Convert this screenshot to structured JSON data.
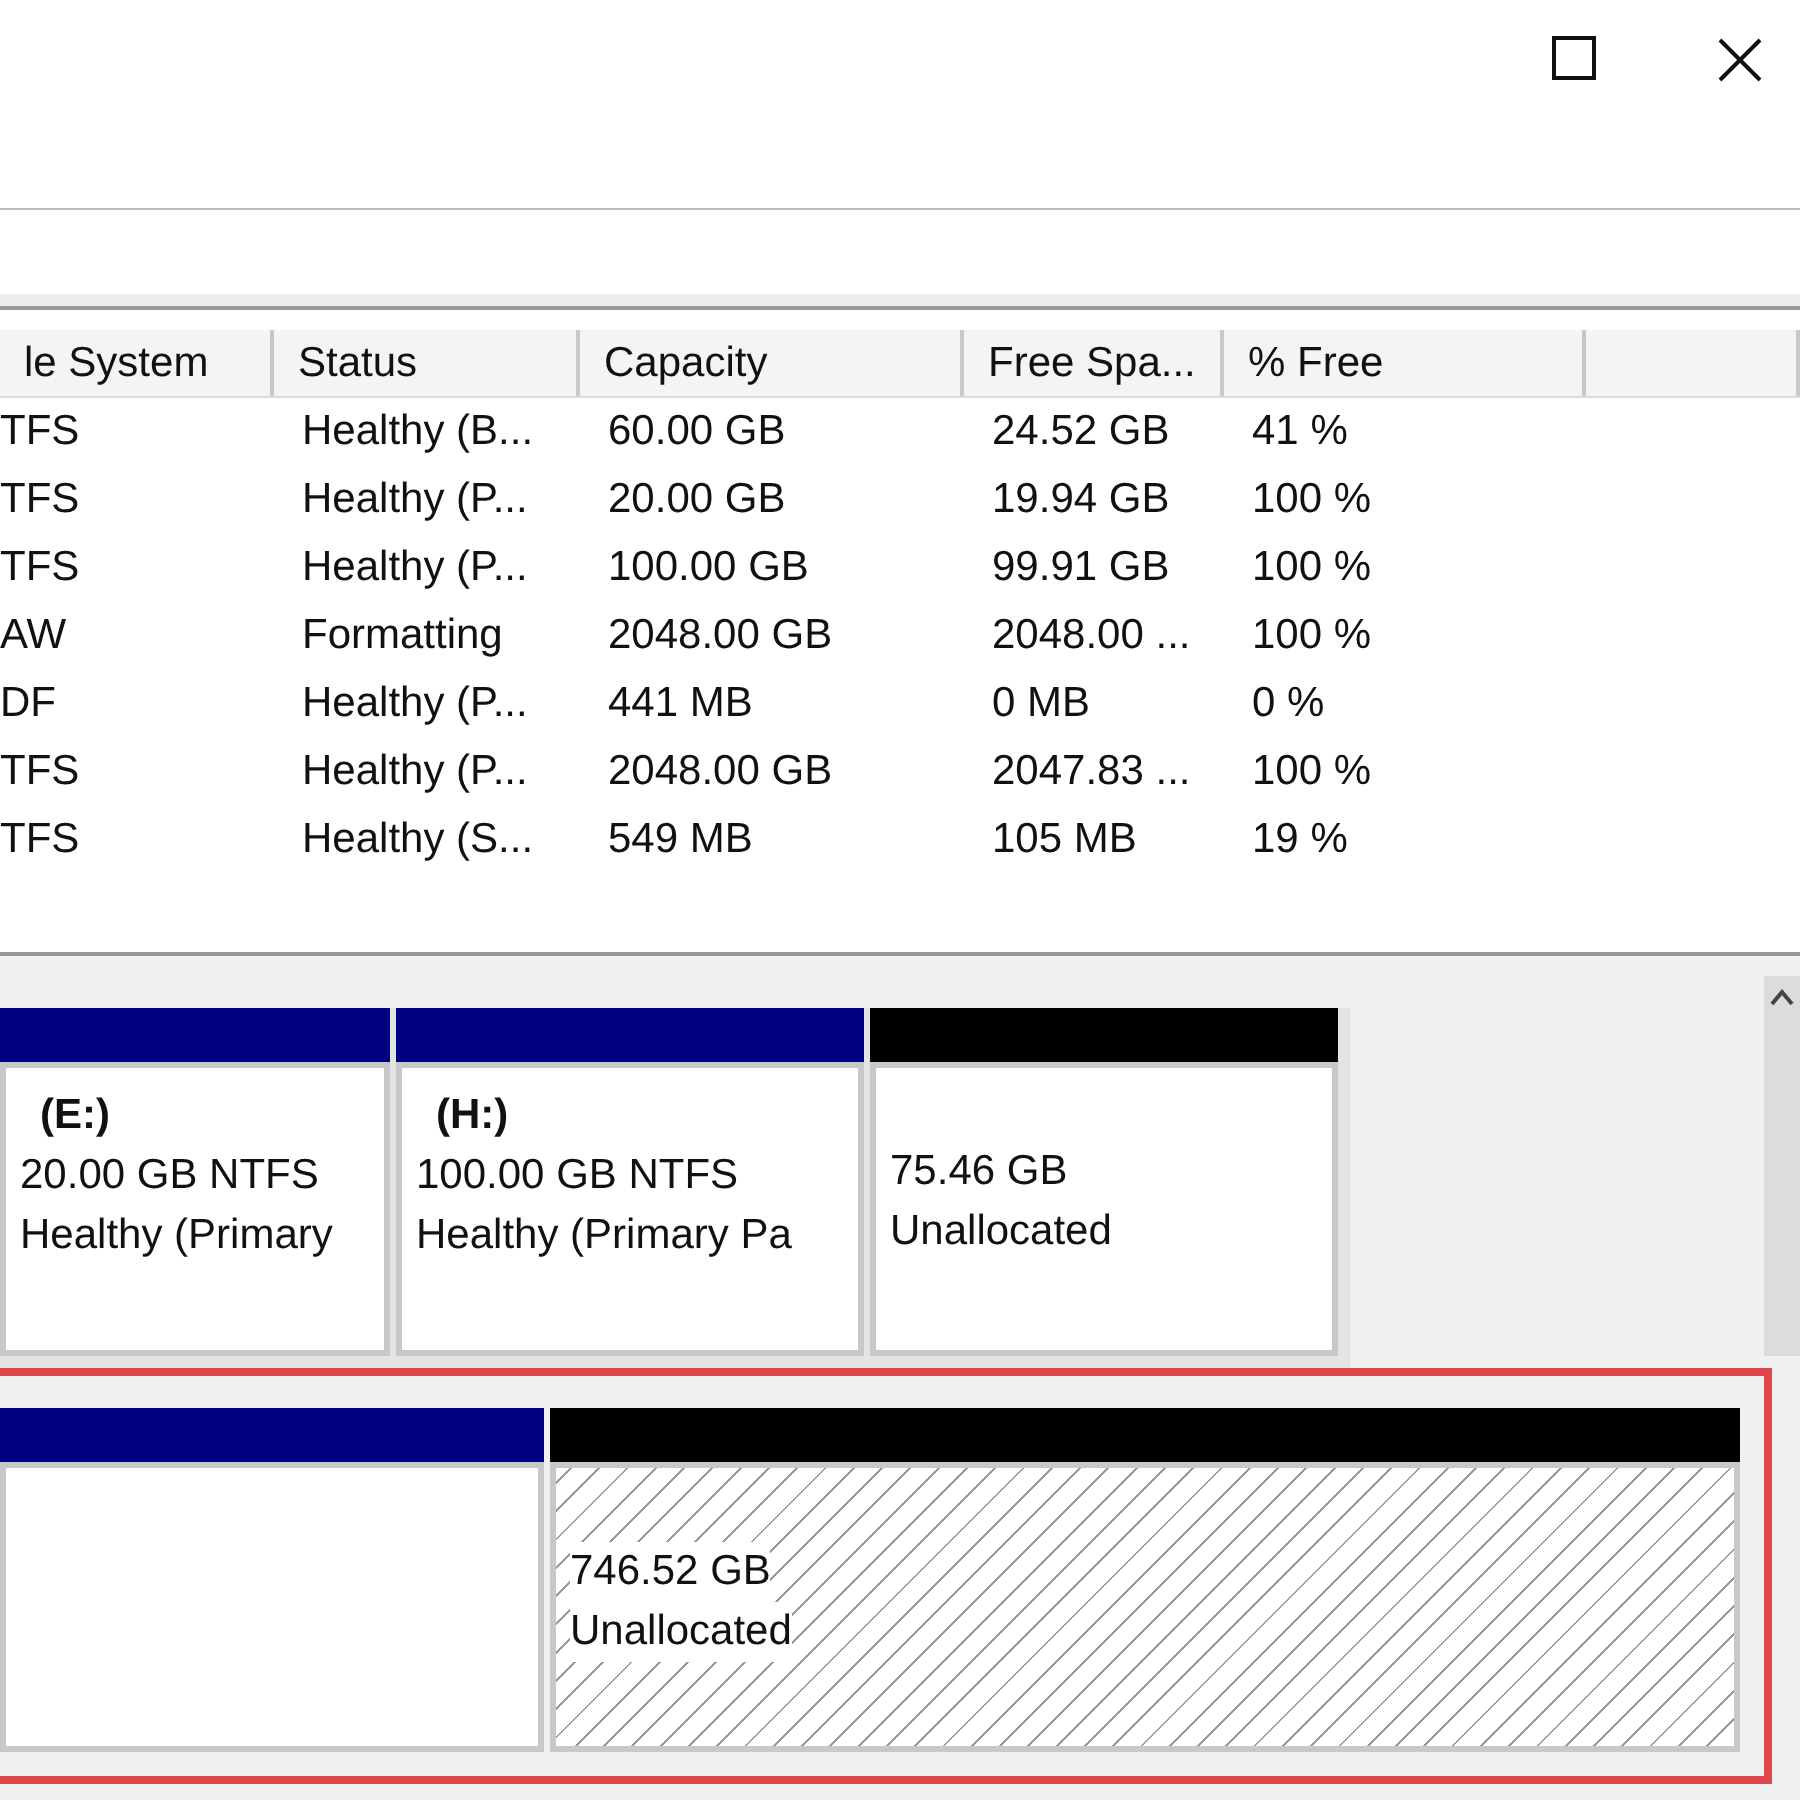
{
  "table": {
    "columns": [
      "le System",
      "Status",
      "Capacity",
      "Free Spa...",
      "% Free",
      ""
    ],
    "rows": [
      [
        "TFS",
        "Healthy (B...",
        "60.00 GB",
        "24.52 GB",
        "41 %"
      ],
      [
        "TFS",
        "Healthy (P...",
        "20.00 GB",
        "19.94 GB",
        "100 %"
      ],
      [
        "TFS",
        "Healthy (P...",
        "100.00 GB",
        "99.91 GB",
        "100 %"
      ],
      [
        "AW",
        "Formatting",
        "2048.00 GB",
        "2048.00 ...",
        "100 %"
      ],
      [
        "DF",
        "Healthy (P...",
        "441 MB",
        "0 MB",
        "0 %"
      ],
      [
        "TFS",
        "Healthy (P...",
        "2048.00 GB",
        "2047.83 ...",
        "100 %"
      ],
      [
        "TFS",
        "Healthy (S...",
        "549 MB",
        "105 MB",
        "19 %"
      ]
    ]
  },
  "disks": [
    {
      "highlighted": false,
      "partitions": [
        {
          "kind": "primary",
          "selected": false,
          "lines": [
            "(E:)",
            "20.00 GB NTFS",
            "Healthy (Primary"
          ]
        },
        {
          "kind": "primary",
          "selected": false,
          "lines": [
            "(H:)",
            "100.00 GB NTFS",
            "Healthy (Primary Pa"
          ]
        },
        {
          "kind": "unallocated",
          "selected": false,
          "lines": [
            "75.46 GB",
            "Unallocated"
          ]
        }
      ]
    },
    {
      "highlighted": true,
      "partitions": [
        {
          "kind": "primary",
          "selected": false
        },
        {
          "kind": "unallocated",
          "selected": true,
          "lines": [
            "746.52 GB",
            "Unallocated"
          ]
        }
      ]
    }
  ]
}
